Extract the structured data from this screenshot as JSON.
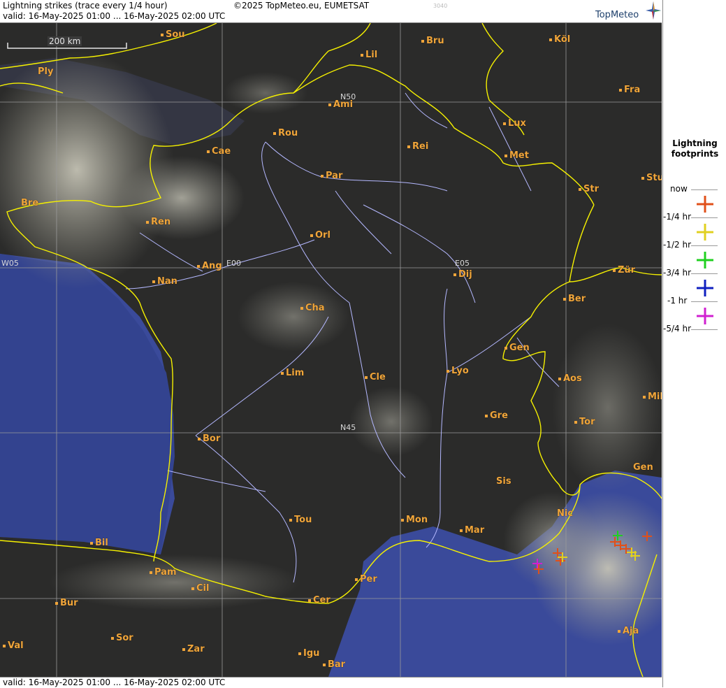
{
  "header": {
    "title": "Lightning strikes (trace every 1/4 hour)",
    "valid": "valid:  16-May-2025 01:00 ... 16-May-2025 02:00 UTC",
    "copyright": "©2025 TopMeteo.eu, EUMETSAT",
    "code": "3040",
    "logo": "TopMeteo"
  },
  "footer": {
    "valid": "valid:  16-May-2025 01:00 ... 16-May-2025 02:00 UTC"
  },
  "scale": {
    "label": "200 km"
  },
  "grid_labels": [
    "N50",
    "N45",
    "W05",
    "E00",
    "E05"
  ],
  "legend": {
    "title": "Lightning footprints",
    "items": [
      {
        "label": "now",
        "color": ""
      },
      {
        "label": "-1/4 hr",
        "color": "#e0501a"
      },
      {
        "label": "-1/2 hr",
        "color": "#e0d020"
      },
      {
        "label": "-3/4 hr",
        "color": "#20d020"
      },
      {
        "label": "-1 hr",
        "color": "#1020c0"
      },
      {
        "label": "-5/4 hr",
        "color": "#d020d0"
      }
    ]
  },
  "cities": [
    "Sou",
    "Bru",
    "Köl",
    "Ply",
    "Lil",
    "Fra",
    "Ami",
    "Lux",
    "Rou",
    "Cae",
    "Rei",
    "Met",
    "Par",
    "Stu",
    "Bre",
    "Str",
    "Ren",
    "Orl",
    "Zür",
    "Ang",
    "Nan",
    "Dij",
    "Ber",
    "Cha",
    "Gen",
    "Lim",
    "Cle",
    "Lyo",
    "Aos",
    "Mil",
    "Gre",
    "Tor",
    "Bor",
    "Gen",
    "Sis",
    "Nic",
    "Tou",
    "Mon",
    "Mar",
    "Bil",
    "Pam",
    "Cil",
    "Per",
    "Cer",
    "Bur",
    "Sor",
    "Aja",
    "Val",
    "Zar",
    "Igu",
    "Bar"
  ],
  "colors": {
    "border": "#f5f000",
    "river": "#b4b8ff",
    "sea": "#3a4a9a",
    "label": "#f0a53a"
  }
}
